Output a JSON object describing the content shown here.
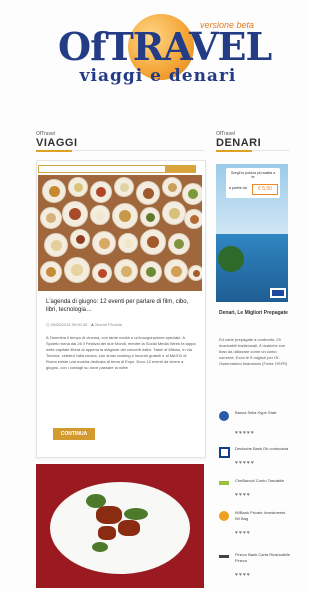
{
  "header": {
    "brand": "OfTRAVEL",
    "tag": "versione beta",
    "subtitle": "viaggi e denari"
  },
  "viaggi": {
    "eyebrow": "OfTravel",
    "title": "VIAGGI"
  },
  "denari": {
    "eyebrow": "OfTravel",
    "title": "DENARI"
  },
  "post": {
    "title": "L'agenda di giugno: 12 eventi per parlare di film, cibo, libri, tecnologia…",
    "date": "05/06/2015 09:00:35",
    "author": "Noemi Picciola",
    "excerpt": "A Taormina il tempo di cinema, con tante novità e un'inaugurazione speciale. A Spoleto torna dal 26 il Festival dei due Mondi, mentre la Social Media Week fa tappa nella capitale libera ai appena la stagione dei concerti estivi. Taste of Milano, in via Tortona, celebra l'alta cucina, con show cooking e incontri gratuiti e al MAXXI di Roma esiste una mostra dedicata al tema di Expo. Ecco 12 eventi da vivere a giugno, con i consigli su dove passare la notte",
    "button": "CONTINUA"
  },
  "ad": {
    "headline": "Scegli la polizza più adatta a te",
    "label": "a partire da",
    "price": "€ 5,50"
  },
  "sidebar": {
    "article_title": "Denari, Le Migliori Prepagate",
    "article_text": "Ed carte prepagate a confronto: 29 ricaricabili tradizionali, 8 ricariche con Iban da utilizzare come un conto corrente. Ecco le 5 migliori per Of-Osservatorio finanziario (Fonte OSFR)",
    "banks": [
      {
        "name": "Banca Sella Hype Start",
        "stars": "♥♥♥♥♥"
      },
      {
        "name": "Deutsche Bank Db contocarta",
        "stars": "♥♥♥♥♥"
      },
      {
        "name": "CheBanca! Conto Tascabile",
        "stars": "♥♥♥♥"
      },
      {
        "name": "IWBank Private Investments IW Bag",
        "stars": "♥♥♥♥"
      },
      {
        "name": "Fineco Bank Carta Ricaricabile Fineco",
        "stars": "♥♥♥♥"
      }
    ]
  },
  "colors": {
    "brand": "#243c86",
    "accent": "#d39a2f",
    "orange": "#e07b20"
  }
}
